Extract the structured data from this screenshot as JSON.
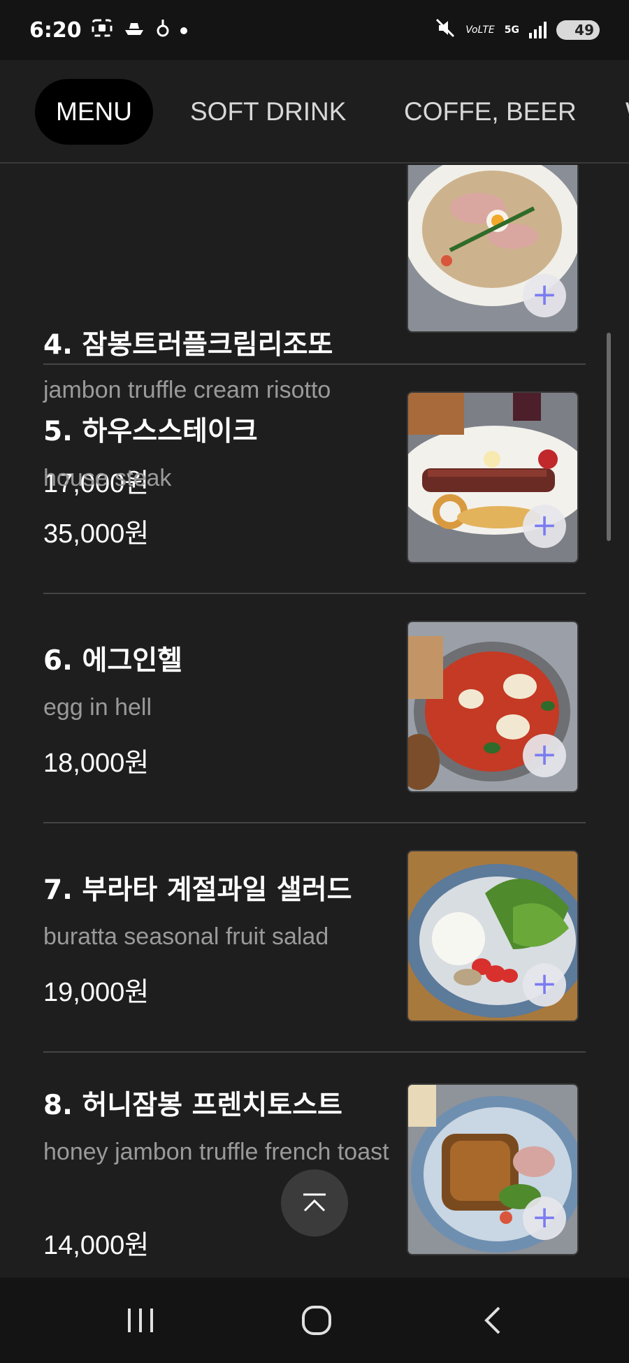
{
  "status_bar": {
    "time": "6:20",
    "left_icons": [
      "screenshot-icon",
      "boat-icon",
      "touch-icon",
      "notification-dot-icon"
    ],
    "network": "VoLTE",
    "network_type": "5G",
    "battery": "49"
  },
  "tabs": [
    {
      "label": "MENU",
      "active": true
    },
    {
      "label": "SOFT DRINK",
      "active": false
    },
    {
      "label": "COFFE, BEER",
      "active": false
    },
    {
      "label": "W",
      "active": false
    }
  ],
  "menu_items": [
    {
      "name": "4. 잠봉트러플크림리조또",
      "desc": "jambon truffle cream risotto",
      "price": "17,000원",
      "photo": "risotto-photo",
      "add_label": "+"
    },
    {
      "name": "5. 하우스스테이크",
      "desc": "house steak",
      "price": "35,000원",
      "photo": "steak-photo",
      "add_label": "+"
    },
    {
      "name": "6. 에그인헬",
      "desc": "egg in hell",
      "price": "18,000원",
      "photo": "shakshuka-photo",
      "add_label": "+"
    },
    {
      "name": "7. 부라타 계절과일 샐러드",
      "desc": "buratta seasonal fruit salad",
      "price": "19,000원",
      "photo": "salad-photo",
      "add_label": "+"
    },
    {
      "name": "8. 허니잠봉 프렌치토스트",
      "desc": "honey jambon truffle french toast",
      "price": "14,000원",
      "photo": "french-toast-photo",
      "add_label": "+"
    }
  ],
  "colors": {
    "background": "#1e1e1e",
    "active_tab": "#000000",
    "add_icon": "#7b7cf0"
  },
  "nav_bar": {
    "icons": [
      "recent-apps-icon",
      "home-icon",
      "back-icon"
    ]
  }
}
